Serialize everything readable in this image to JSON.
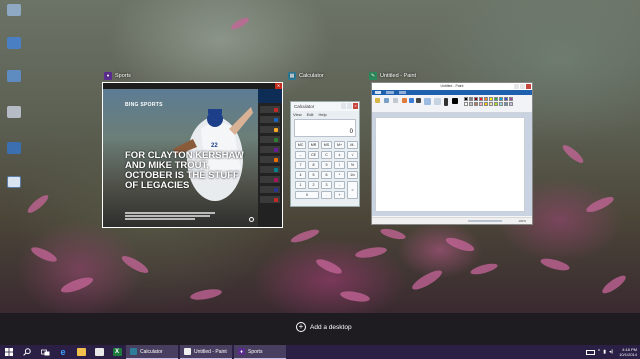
{
  "desktop": {
    "icons": [
      {
        "name": "recycle-bin-icon",
        "label": ""
      },
      {
        "name": "computer-icon",
        "label": ""
      },
      {
        "name": "network-icon",
        "label": ""
      },
      {
        "name": "trash-icon",
        "label": ""
      },
      {
        "name": "folder-icon",
        "label": ""
      },
      {
        "name": "shortcut-icon",
        "label": ""
      }
    ]
  },
  "task_view": {
    "windows": [
      {
        "title": "Sports",
        "app_icon": "trophy-icon",
        "content": {
          "brand": "BING SPORTS",
          "headline": "FOR CLAYTON KERSHAW AND MIKE TROUT, OCTOBER IS THE STUFF OF LEGACIES",
          "side_rows": [
            "",
            "",
            "",
            "",
            "",
            "",
            "",
            "",
            "",
            "",
            "",
            "",
            "",
            "",
            ""
          ]
        }
      },
      {
        "title": "Calculator",
        "app_icon": "calculator-icon",
        "content": {
          "window_title": "Calculator",
          "menu": [
            "View",
            "Edit",
            "Help"
          ],
          "display": "0",
          "keys": [
            "MC",
            "MR",
            "MS",
            "M+",
            "M-",
            "←",
            "CE",
            "C",
            "±",
            "√",
            "7",
            "8",
            "9",
            "/",
            "%",
            "4",
            "5",
            "6",
            "*",
            "1/x",
            "1",
            "2",
            "3",
            "-",
            "=",
            "0",
            ".",
            "+"
          ]
        }
      },
      {
        "title": "Untitled - Paint",
        "app_icon": "paint-icon",
        "content": {
          "window_title": "Untitled - Paint",
          "status_zoom": "100%"
        }
      }
    ]
  },
  "desktops_bar": {
    "add_label": "Add a desktop"
  },
  "taskbar": {
    "apps": [
      {
        "label": "Calculator",
        "icon": "calculator-icon"
      },
      {
        "label": "Untitled - Paint",
        "icon": "paint-icon"
      },
      {
        "label": "Sports",
        "icon": "trophy-icon"
      }
    ],
    "clock": {
      "time": "4:18 PM",
      "date": "10/1/2014"
    }
  },
  "colors": {
    "taskbar": "#2b1f45",
    "accent": "#1e5fae",
    "sports_header": "#0e2d56"
  }
}
